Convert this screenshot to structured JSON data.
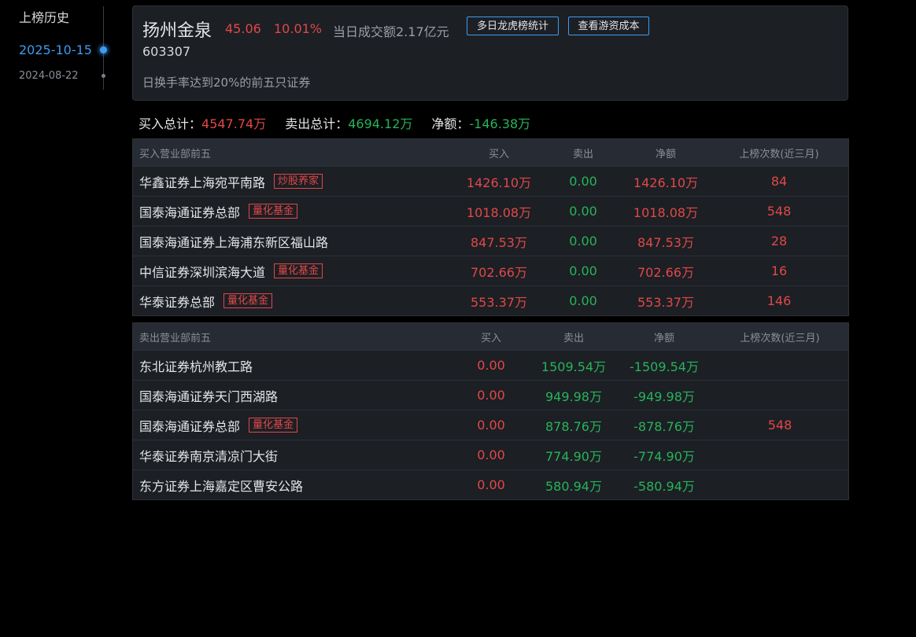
{
  "timeline": {
    "title": "上榜历史",
    "items": [
      {
        "date": "2025-10-15",
        "active": true
      },
      {
        "date": "2024-08-22",
        "active": false
      }
    ]
  },
  "header": {
    "name": "扬州金泉",
    "price": "45.06",
    "change": "10.01%",
    "turnover": "当日成交额2.17亿元",
    "btn_multiday": "多日龙虎榜统计",
    "btn_cost": "查看游资成本",
    "code": "603307",
    "reason": "日换手率达到20%的前五只证券"
  },
  "totals": {
    "buy_label": "买入总计：",
    "buy_value": "4547.74万",
    "sell_label": "卖出总计：",
    "sell_value": "4694.12万",
    "net_label": "净额：",
    "net_value": "-146.38万"
  },
  "buy_table": {
    "headers": [
      "买入营业部前五",
      "买入",
      "卖出",
      "净额",
      "上榜次数(近三月)"
    ],
    "rows": [
      {
        "name": "华鑫证券上海宛平南路",
        "tag": "炒股养家",
        "buy": "1426.10万",
        "sell": "0.00",
        "net": "1426.10万",
        "count": "84"
      },
      {
        "name": "国泰海通证券总部",
        "tag": "量化基金",
        "buy": "1018.08万",
        "sell": "0.00",
        "net": "1018.08万",
        "count": "548"
      },
      {
        "name": "国泰海通证券上海浦东新区福山路",
        "tag": "",
        "buy": "847.53万",
        "sell": "0.00",
        "net": "847.53万",
        "count": "28"
      },
      {
        "name": "中信证券深圳滨海大道",
        "tag": "量化基金",
        "buy": "702.66万",
        "sell": "0.00",
        "net": "702.66万",
        "count": "16"
      },
      {
        "name": "华泰证券总部",
        "tag": "量化基金",
        "buy": "553.37万",
        "sell": "0.00",
        "net": "553.37万",
        "count": "146"
      }
    ]
  },
  "sell_table": {
    "headers": [
      "卖出营业部前五",
      "买入",
      "卖出",
      "净额",
      "上榜次数(近三月)"
    ],
    "rows": [
      {
        "name": "东北证券杭州教工路",
        "tag": "",
        "buy": "0.00",
        "sell": "1509.54万",
        "net": "-1509.54万",
        "count": ""
      },
      {
        "name": "国泰海通证券天门西湖路",
        "tag": "",
        "buy": "0.00",
        "sell": "949.98万",
        "net": "-949.98万",
        "count": ""
      },
      {
        "name": "国泰海通证券总部",
        "tag": "量化基金",
        "buy": "0.00",
        "sell": "878.76万",
        "net": "-878.76万",
        "count": "548"
      },
      {
        "name": "华泰证券南京清凉门大街",
        "tag": "",
        "buy": "0.00",
        "sell": "774.90万",
        "net": "-774.90万",
        "count": ""
      },
      {
        "name": "东方证券上海嘉定区曹安公路",
        "tag": "",
        "buy": "0.00",
        "sell": "580.94万",
        "net": "-580.94万",
        "count": ""
      }
    ]
  },
  "colors": {
    "up": "#e04848",
    "down": "#27b35a",
    "accent": "#3d9bf0"
  }
}
